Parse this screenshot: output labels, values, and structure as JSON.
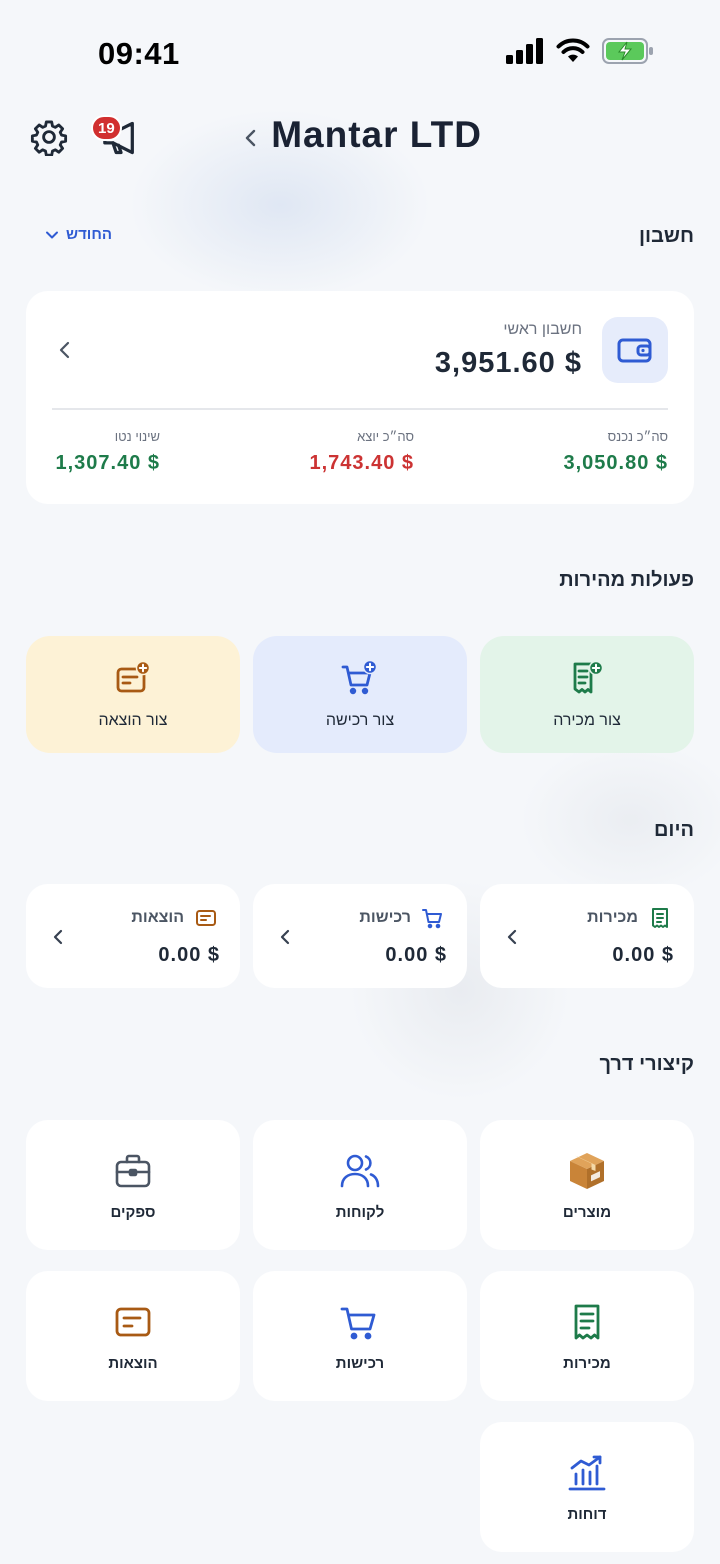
{
  "status_bar": {
    "time": "09:41"
  },
  "header": {
    "title": "Mantar LTD",
    "notification_count": "19"
  },
  "account": {
    "section_title": "חשבון",
    "period_selector": "החודש",
    "account_name": "חשבון ראשי",
    "balance": "3,951.60 $",
    "income_label": "סה״כ נכנס",
    "income_value": "3,050.80 $",
    "outgoing_label": "סה״כ יוצא",
    "outgoing_value": "1,743.40 $",
    "net_label": "שינוי נטו",
    "net_value": "1,307.40 $"
  },
  "quick_actions": {
    "section_title": "פעולות מהירות",
    "create_sale": "צור מכירה",
    "create_purchase": "צור רכישה",
    "create_expense": "צור הוצאה"
  },
  "today": {
    "section_title": "היום",
    "sales_label": "מכירות",
    "sales_value": "0.00 $",
    "purchases_label": "רכישות",
    "purchases_value": "0.00 $",
    "expenses_label": "הוצאות",
    "expenses_value": "0.00 $"
  },
  "shortcuts": {
    "section_title": "קיצורי דרך",
    "products": "מוצרים",
    "customers": "לקוחות",
    "suppliers": "ספקים",
    "sales": "מכירות",
    "purchases": "רכישות",
    "expenses": "הוצאות",
    "reports": "דוחות"
  },
  "colors": {
    "accent_blue": "#2f5bd3",
    "income_green": "#1e7b4a",
    "outgoing_red": "#cc3333",
    "sale_bg": "#e3f4e9",
    "purchase_bg": "#e4ebfc",
    "expense_bg": "#fdf2d6",
    "expense_brown": "#a85a14"
  }
}
